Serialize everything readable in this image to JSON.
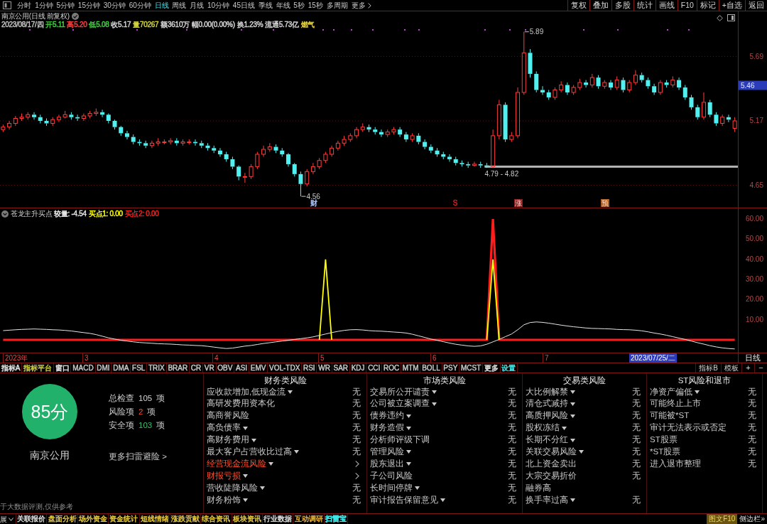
{
  "toolbar": {
    "periods": [
      {
        "label": "分时",
        "selected": false
      },
      {
        "label": "1分钟",
        "selected": false
      },
      {
        "label": "5分钟",
        "selected": false
      },
      {
        "label": "15分钟",
        "selected": false
      },
      {
        "label": "30分钟",
        "selected": false
      },
      {
        "label": "60分钟",
        "selected": false
      },
      {
        "label": "日线",
        "selected": true
      },
      {
        "label": "周线",
        "selected": false
      },
      {
        "label": "月线",
        "selected": false
      },
      {
        "label": "10分钟",
        "selected": false
      },
      {
        "label": "45日线",
        "selected": false
      },
      {
        "label": "季线",
        "selected": false
      },
      {
        "label": "年线",
        "selected": false
      },
      {
        "label": "5秒",
        "selected": false
      },
      {
        "label": "15秒",
        "selected": false
      },
      {
        "label": "多周期",
        "selected": false
      }
    ],
    "more": "更多",
    "buttons": [
      "复权",
      "叠加",
      "多股",
      "统计",
      "画线",
      "F10",
      "标记",
      "+自选",
      "返回"
    ]
  },
  "price_panel": {
    "title": "南京公用(日线 前复权)",
    "quote": [
      {
        "text": "2023/08/17/四",
        "color": "#c4c4c4"
      },
      {
        "text": "开5.11",
        "color": "#3ed23e"
      },
      {
        "text": "高5.20",
        "color": "#ff4040"
      },
      {
        "text": "低5.08",
        "color": "#3ed23e"
      },
      {
        "text": "收5.17",
        "color": "#d4d4d4"
      },
      {
        "text": "量70267",
        "color": "#d2d23c"
      },
      {
        "text": "额3610万",
        "color": "#d4d4d4"
      },
      {
        "text": "幅0.00(0.00%)",
        "color": "#d4d4d4"
      },
      {
        "text": "换1.23%",
        "color": "#d4d4d4"
      },
      {
        "text": "流通5.73亿",
        "color": "#d4d4d4"
      },
      {
        "text": "燃气",
        "color": "#e6d23c"
      }
    ],
    "chart_data": {
      "type": "candlestick",
      "ylim": [
        4.469,
        6.055
      ],
      "yticks": [
        {
          "value": 5.69,
          "label": "5.69"
        },
        {
          "value": 5.17,
          "label": "5.17"
        },
        {
          "value": 4.65,
          "label": "4.65"
        }
      ],
      "grid": true,
      "ohlc": [
        [
          5.1,
          5.14,
          5.08,
          5.12
        ],
        [
          5.12,
          5.17,
          5.1,
          5.15
        ],
        [
          5.15,
          5.21,
          5.13,
          5.19
        ],
        [
          5.19,
          5.23,
          5.17,
          5.2
        ],
        [
          5.2,
          5.24,
          5.18,
          5.22
        ],
        [
          5.22,
          5.24,
          5.18,
          5.2
        ],
        [
          5.2,
          5.22,
          5.15,
          5.17
        ],
        [
          5.17,
          5.19,
          5.13,
          5.15
        ],
        [
          5.15,
          5.2,
          5.13,
          5.18
        ],
        [
          5.18,
          5.22,
          5.16,
          5.2
        ],
        [
          5.2,
          5.25,
          5.19,
          5.22
        ],
        [
          5.22,
          5.24,
          5.18,
          5.2
        ],
        [
          5.2,
          5.22,
          5.17,
          5.19
        ],
        [
          5.19,
          5.23,
          5.17,
          5.21
        ],
        [
          5.21,
          5.25,
          5.19,
          5.23
        ],
        [
          5.23,
          5.27,
          5.21,
          5.24
        ],
        [
          5.24,
          5.26,
          5.2,
          5.22
        ],
        [
          5.22,
          5.23,
          5.15,
          5.17
        ],
        [
          5.17,
          5.18,
          5.1,
          5.12
        ],
        [
          5.12,
          5.13,
          5.05,
          5.07
        ],
        [
          5.07,
          5.09,
          5.02,
          5.04
        ],
        [
          5.04,
          5.06,
          4.98,
          5.0
        ],
        [
          5.0,
          5.02,
          4.97,
          4.99
        ],
        [
          4.99,
          5.01,
          4.95,
          4.97
        ],
        [
          4.97,
          5.01,
          4.95,
          4.99
        ],
        [
          4.99,
          5.03,
          4.97,
          5.0
        ],
        [
          5.0,
          5.02,
          4.98,
          5.0
        ],
        [
          5.0,
          5.03,
          4.98,
          5.01
        ],
        [
          5.01,
          5.03,
          4.97,
          4.99
        ],
        [
          4.99,
          5.02,
          4.97,
          5.0
        ],
        [
          5.0,
          5.02,
          4.98,
          5.0
        ],
        [
          5.0,
          5.02,
          4.97,
          4.99
        ],
        [
          4.99,
          5.01,
          4.95,
          4.97
        ],
        [
          4.97,
          4.99,
          4.93,
          4.95
        ],
        [
          4.95,
          4.97,
          4.91,
          4.93
        ],
        [
          4.93,
          4.95,
          4.88,
          4.9
        ],
        [
          4.9,
          4.92,
          4.84,
          4.86
        ],
        [
          4.86,
          4.88,
          4.78,
          4.8
        ],
        [
          4.8,
          4.81,
          4.69,
          4.72
        ],
        [
          4.72,
          4.75,
          4.67,
          4.72
        ],
        [
          4.72,
          4.82,
          4.7,
          4.8
        ],
        [
          4.8,
          4.92,
          4.78,
          4.9
        ],
        [
          4.9,
          4.97,
          4.88,
          4.94
        ],
        [
          4.94,
          4.99,
          4.92,
          4.96
        ],
        [
          4.96,
          4.98,
          4.91,
          4.93
        ],
        [
          4.93,
          4.95,
          4.88,
          4.9
        ],
        [
          4.9,
          4.91,
          4.8,
          4.82
        ],
        [
          4.82,
          4.83,
          4.72,
          4.74
        ],
        [
          4.74,
          4.76,
          4.56,
          4.66
        ],
        [
          4.66,
          4.78,
          4.64,
          4.76
        ],
        [
          4.76,
          4.83,
          4.74,
          4.8
        ],
        [
          4.8,
          4.87,
          4.78,
          4.85
        ],
        [
          4.85,
          4.92,
          4.83,
          4.9
        ],
        [
          4.9,
          4.97,
          4.88,
          4.95
        ],
        [
          4.95,
          5.01,
          4.93,
          4.99
        ],
        [
          4.99,
          5.05,
          4.97,
          5.02
        ],
        [
          5.02,
          5.07,
          5.0,
          5.05
        ],
        [
          5.05,
          5.12,
          5.03,
          5.1
        ],
        [
          5.1,
          5.15,
          5.08,
          5.12
        ],
        [
          5.12,
          5.14,
          5.08,
          5.1
        ],
        [
          5.1,
          5.12,
          5.06,
          5.08
        ],
        [
          5.08,
          5.1,
          5.04,
          5.06
        ],
        [
          5.06,
          5.1,
          5.04,
          5.08
        ],
        [
          5.08,
          5.12,
          5.06,
          5.1
        ],
        [
          5.1,
          5.12,
          5.04,
          5.06
        ],
        [
          5.06,
          5.08,
          5.0,
          5.02
        ],
        [
          5.02,
          5.07,
          5.0,
          5.05
        ],
        [
          5.05,
          5.07,
          4.98,
          5.0
        ],
        [
          5.0,
          5.02,
          4.94,
          4.96
        ],
        [
          4.96,
          4.98,
          4.91,
          4.93
        ],
        [
          4.93,
          4.95,
          4.88,
          4.9
        ],
        [
          4.9,
          4.92,
          4.86,
          4.88
        ],
        [
          4.88,
          4.9,
          4.84,
          4.86
        ],
        [
          4.86,
          4.88,
          4.81,
          4.83
        ],
        [
          4.83,
          4.85,
          4.8,
          4.82
        ],
        [
          4.82,
          4.84,
          4.79,
          4.81
        ],
        [
          4.81,
          4.84,
          4.8,
          4.82
        ],
        [
          4.82,
          4.84,
          4.79,
          4.81
        ],
        [
          4.81,
          4.83,
          4.79,
          4.8
        ],
        [
          4.8,
          5.1,
          4.79,
          5.05
        ],
        [
          5.05,
          5.34,
          5.02,
          5.3
        ],
        [
          5.3,
          5.32,
          5.0,
          5.02
        ],
        [
          5.02,
          5.08,
          5.0,
          5.05
        ],
        [
          5.05,
          5.44,
          5.03,
          5.4
        ],
        [
          5.4,
          5.89,
          5.38,
          5.72
        ],
        [
          5.72,
          5.75,
          5.52,
          5.55
        ],
        [
          5.55,
          5.57,
          5.4,
          5.42
        ],
        [
          5.42,
          5.45,
          5.38,
          5.4
        ],
        [
          5.4,
          5.42,
          5.34,
          5.36
        ],
        [
          5.36,
          5.44,
          5.34,
          5.42
        ],
        [
          5.42,
          5.49,
          5.4,
          5.46
        ],
        [
          5.46,
          5.48,
          5.38,
          5.4
        ],
        [
          5.4,
          5.46,
          5.38,
          5.44
        ],
        [
          5.44,
          5.51,
          5.42,
          5.48
        ],
        [
          5.48,
          5.5,
          5.44,
          5.46
        ],
        [
          5.46,
          5.55,
          5.44,
          5.52
        ],
        [
          5.52,
          5.54,
          5.43,
          5.45
        ],
        [
          5.45,
          5.5,
          5.43,
          5.48
        ],
        [
          5.48,
          5.5,
          5.42,
          5.44
        ],
        [
          5.44,
          5.53,
          5.42,
          5.5
        ],
        [
          5.5,
          5.52,
          5.4,
          5.42
        ],
        [
          5.42,
          5.5,
          5.4,
          5.48
        ],
        [
          5.48,
          5.58,
          5.46,
          5.54
        ],
        [
          5.54,
          5.56,
          5.48,
          5.5
        ],
        [
          5.5,
          5.52,
          5.43,
          5.45
        ],
        [
          5.45,
          5.47,
          5.38,
          5.4
        ],
        [
          5.4,
          5.5,
          5.38,
          5.48
        ],
        [
          5.48,
          5.5,
          5.44,
          5.46
        ],
        [
          5.46,
          5.53,
          5.44,
          5.5
        ],
        [
          5.5,
          5.52,
          5.42,
          5.44
        ],
        [
          5.44,
          5.46,
          5.34,
          5.36
        ],
        [
          5.36,
          5.38,
          5.26,
          5.28
        ],
        [
          5.28,
          5.3,
          5.18,
          5.2
        ],
        [
          5.2,
          5.4,
          5.18,
          5.32
        ],
        [
          5.32,
          5.34,
          5.2,
          5.22
        ],
        [
          5.22,
          5.24,
          5.13,
          5.15
        ],
        [
          5.15,
          5.22,
          5.13,
          5.2
        ],
        [
          5.2,
          5.22,
          5.16,
          5.18
        ],
        [
          5.11,
          5.2,
          5.08,
          5.17
        ]
      ],
      "annotations": [
        "5.89",
        "5.46",
        "4.79 - 4.82",
        "4.56"
      ]
    },
    "event_marks": [
      {
        "text": "财",
        "color": "#a8c4ff",
        "boxed": false
      },
      {
        "text": "S",
        "color": "#e02020",
        "boxed": false
      },
      {
        "text": "涨",
        "color": "#8a2020",
        "boxed": true
      },
      {
        "text": "预",
        "color": "#a85a20",
        "boxed": true
      }
    ]
  },
  "indicator_panel": {
    "name": "苍龙主升买点",
    "readouts": [
      {
        "text": "较量: -4.54",
        "color": "#e6e6e6"
      },
      {
        "text": "买点1: 0.00",
        "color": "#ffff00"
      },
      {
        "text": "买点2: 0.00",
        "color": "#ff1e1e"
      }
    ],
    "chart_data": {
      "type": "line",
      "ylim": [
        -6.35,
        65.65
      ],
      "yticks": [
        {
          "value": 60,
          "label": "60.00"
        },
        {
          "value": 50,
          "label": "50.00"
        },
        {
          "value": 40,
          "label": "40.00"
        },
        {
          "value": 30,
          "label": "30.00"
        },
        {
          "value": 20,
          "label": "20.00"
        },
        {
          "value": 10,
          "label": "10.00"
        }
      ],
      "series": [
        {
          "color": "#e6e6e6",
          "values": [
            4.6,
            4.8,
            5.0,
            5.2,
            5.3,
            5.4,
            5.3,
            5.2,
            5.0,
            4.9,
            4.7,
            4.4,
            4.0,
            3.6,
            3.2,
            2.6,
            1.8,
            1.0,
            0.4,
            -0.2,
            -0.6,
            -1.0,
            -1.3,
            -1.5,
            -1.7,
            -1.9,
            -2.0,
            -2.1,
            -2.3,
            -2.5,
            -2.6,
            -2.8,
            -2.9,
            -3.2,
            -3.6,
            -4.0,
            -4.3,
            -4.1,
            -3.6,
            -3.1,
            -2.8,
            -2.3,
            -1.8,
            -1.4,
            -1.0,
            -0.6,
            -0.2,
            0.2,
            0.6,
            1.0,
            1.5,
            2.2,
            2.9,
            3.6,
            4.2,
            4.7,
            5.0,
            5.1,
            4.9,
            4.6,
            4.4,
            4.3,
            4.1,
            3.9,
            3.7,
            3.4,
            2.8,
            2.0,
            1.2,
            0.4,
            -0.2,
            -0.9,
            -1.6,
            -2.2,
            -2.6,
            -3.0,
            -3.2,
            -3.0,
            -2.2,
            -1.0,
            0.2,
            1.6,
            2.9,
            5.0,
            7.5,
            8.6,
            8.9,
            8.7,
            8.3,
            7.8,
            7.3,
            6.9,
            6.5,
            6.2,
            5.9,
            5.7,
            5.6,
            5.5,
            5.4,
            5.2,
            5.1,
            5.0,
            4.8,
            4.5,
            4.0,
            3.4,
            2.9,
            2.3,
            1.6,
            0.9,
            0.2,
            -0.6,
            -1.4,
            -2.1,
            -2.9,
            -3.5,
            -4.0,
            -4.3,
            -4.5
          ]
        },
        {
          "color": "#ffff00",
          "values": [
            null,
            null,
            null,
            null,
            null,
            null,
            null,
            null,
            null,
            null,
            null,
            null,
            null,
            null,
            null,
            null,
            null,
            null,
            null,
            null,
            null,
            null,
            null,
            null,
            null,
            null,
            null,
            null,
            null,
            null,
            null,
            null,
            null,
            null,
            null,
            null,
            null,
            null,
            null,
            null,
            null,
            null,
            null,
            null,
            null,
            null,
            null,
            null,
            null,
            null,
            null,
            0,
            40,
            0,
            null,
            null,
            null,
            null,
            null,
            null,
            null,
            null,
            null,
            null,
            null,
            null,
            null,
            null,
            null,
            null,
            null,
            null,
            null,
            null,
            null,
            null,
            null,
            null,
            0,
            40,
            0,
            null,
            null,
            null,
            null,
            null,
            null,
            null,
            null,
            null,
            null,
            null,
            null,
            null,
            null,
            null,
            null,
            null,
            null,
            null,
            null,
            null,
            null,
            null,
            null,
            null,
            null,
            null,
            null,
            null,
            null,
            null,
            null,
            null,
            null,
            null,
            null,
            null,
            null
          ]
        },
        {
          "color": "#ff1e1e",
          "values": [
            0,
            0,
            0,
            0,
            0,
            0,
            0,
            0,
            0,
            0,
            0,
            0,
            0,
            0,
            0,
            0,
            0,
            0,
            0,
            0,
            0,
            0,
            0,
            0,
            0,
            0,
            0,
            0,
            0,
            0,
            0,
            0,
            0,
            0,
            0,
            0,
            0,
            0,
            0,
            0,
            0,
            0,
            0,
            0,
            0,
            0,
            0,
            0,
            0,
            0,
            0,
            0,
            0,
            0,
            0,
            0,
            0,
            0,
            0,
            0,
            0,
            0,
            0,
            0,
            0,
            0,
            0,
            0,
            0,
            0,
            0,
            0,
            0,
            0,
            0,
            0,
            0,
            0,
            0,
            60,
            0,
            0,
            0,
            0,
            0,
            0,
            0,
            0,
            0,
            0,
            0,
            0,
            0,
            0,
            0,
            0,
            0,
            0,
            0,
            0,
            0,
            0,
            0,
            0,
            0,
            0,
            0,
            0,
            0,
            0,
            0,
            0,
            0,
            0,
            0,
            0,
            0,
            0,
            0
          ]
        }
      ]
    }
  },
  "date_axis": {
    "ticks": [
      "2023年",
      "3",
      "4",
      "5",
      "6",
      "7"
    ],
    "cursor_date": "2023/07/25/二",
    "period": "日线"
  },
  "indicator_tabs": {
    "items": [
      {
        "label": "指标A",
        "color": "#e6e6e6"
      },
      {
        "label": "指标平台",
        "color": "#d2d23c"
      },
      {
        "label": "窗口",
        "color": "#e6e6e6"
      },
      {
        "label": "MACD",
        "color": "#c8c8c8"
      },
      {
        "label": "DMI",
        "color": "#c8c8c8"
      },
      {
        "label": "DMA",
        "color": "#c8c8c8"
      },
      {
        "label": "FSL",
        "color": "#c8c8c8"
      },
      {
        "label": "TRIX",
        "color": "#c8c8c8"
      },
      {
        "label": "BRAR",
        "color": "#c8c8c8"
      },
      {
        "label": "CR",
        "color": "#c8c8c8"
      },
      {
        "label": "VR",
        "color": "#c8c8c8"
      },
      {
        "label": "OBV",
        "color": "#c8c8c8"
      },
      {
        "label": "ASI",
        "color": "#c8c8c8"
      },
      {
        "label": "EMV",
        "color": "#c8c8c8"
      },
      {
        "label": "VOL-TDX",
        "color": "#c8c8c8"
      },
      {
        "label": "RSI",
        "color": "#c8c8c8"
      },
      {
        "label": "WR",
        "color": "#c8c8c8"
      },
      {
        "label": "SAR",
        "color": "#c8c8c8"
      },
      {
        "label": "KDJ",
        "color": "#c8c8c8"
      },
      {
        "label": "CCI",
        "color": "#c8c8c8"
      },
      {
        "label": "ROC",
        "color": "#c8c8c8"
      },
      {
        "label": "MTM",
        "color": "#c8c8c8"
      },
      {
        "label": "BOLL",
        "color": "#c8c8c8"
      },
      {
        "label": "PSY",
        "color": "#c8c8c8"
      },
      {
        "label": "MCST",
        "color": "#c8c8c8"
      },
      {
        "label": "更多",
        "color": "#e6e6e6"
      },
      {
        "label": "设置",
        "color": "#3ce6e6"
      }
    ],
    "right": [
      "指标B",
      "模板",
      "+",
      "−"
    ]
  },
  "risk_scan": {
    "score": "85分",
    "stock_name": "南京公用",
    "stats": [
      {
        "label": "总检查",
        "count": "105",
        "unit": "项",
        "kind": "total"
      },
      {
        "label": "风险项",
        "count": "2",
        "unit": "项",
        "kind": "risk"
      },
      {
        "label": "安全项",
        "count": "103",
        "unit": "项",
        "kind": "safe"
      }
    ],
    "more_link": "更多扫雷避险 >",
    "disclaimer": "于大数据评测,仅供参考",
    "categories": [
      {
        "title": "财务类风险",
        "items": [
          {
            "label": "应收款增加,低现金流",
            "menu": true,
            "risk": false,
            "result": "无"
          },
          {
            "label": "高研发费用资本化",
            "menu": false,
            "risk": false,
            "result": "无"
          },
          {
            "label": "高商誉风险",
            "menu": false,
            "risk": false,
            "result": "无"
          },
          {
            "label": "高负债率",
            "menu": true,
            "risk": false,
            "result": "无"
          },
          {
            "label": "高财务费用",
            "menu": true,
            "risk": false,
            "result": "无"
          },
          {
            "label": "最大客户占营收比过高",
            "menu": true,
            "risk": false,
            "result": "无"
          },
          {
            "label": "经营现金流风险",
            "menu": true,
            "risk": true
          },
          {
            "label": "财报亏损",
            "menu": true,
            "risk": true
          },
          {
            "label": "营收陡降风险",
            "menu": true,
            "risk": false,
            "result": "无"
          },
          {
            "label": "财务粉饰",
            "menu": true,
            "risk": false,
            "result": "无"
          }
        ]
      },
      {
        "title": "市场类风险",
        "items": [
          {
            "label": "交易所公开谴责",
            "menu": true,
            "risk": false,
            "result": "无"
          },
          {
            "label": "公司被立案调查",
            "menu": true,
            "risk": false,
            "result": "无"
          },
          {
            "label": "债券违约",
            "menu": true,
            "risk": false,
            "result": "无"
          },
          {
            "label": "财务造假",
            "menu": true,
            "risk": false,
            "result": "无"
          },
          {
            "label": "分析师评级下调",
            "menu": false,
            "risk": false,
            "result": "无"
          },
          {
            "label": "管理风险",
            "menu": true,
            "risk": false,
            "result": "无"
          },
          {
            "label": "股东退出",
            "menu": true,
            "risk": false,
            "result": "无"
          },
          {
            "label": "子公司风险",
            "menu": false,
            "risk": false,
            "result": "无"
          },
          {
            "label": "长时间停牌",
            "menu": true,
            "risk": false,
            "result": "无"
          },
          {
            "label": "审计报告保留意见",
            "menu": true,
            "risk": false,
            "result": "无"
          }
        ]
      },
      {
        "title": "交易类风险",
        "items": [
          {
            "label": "大比例解禁",
            "menu": true,
            "risk": false,
            "result": "无"
          },
          {
            "label": "清仓式减持",
            "menu": true,
            "risk": false,
            "result": "无"
          },
          {
            "label": "高质押风险",
            "menu": true,
            "risk": false,
            "result": "无"
          },
          {
            "label": "股权冻结",
            "menu": true,
            "risk": false,
            "result": "无"
          },
          {
            "label": "长期不分红",
            "menu": true,
            "risk": false,
            "result": "无"
          },
          {
            "label": "关联交易风险",
            "menu": true,
            "risk": false,
            "result": "无"
          },
          {
            "label": "北上资金卖出",
            "menu": false,
            "risk": false,
            "result": "无"
          },
          {
            "label": "大宗交易折价",
            "menu": false,
            "risk": false,
            "result": "无"
          },
          {
            "label": "融券高",
            "menu": false,
            "risk": false
          },
          {
            "label": "换手率过高",
            "menu": true,
            "risk": false,
            "result": "无"
          }
        ]
      },
      {
        "title": "ST风险和退市",
        "items": [
          {
            "label": "净资产偏低",
            "menu": true,
            "risk": false,
            "result": "无"
          },
          {
            "label": "可能终止上市",
            "menu": false,
            "risk": false,
            "result": "无"
          },
          {
            "label": "可能被*ST",
            "menu": false,
            "risk": false,
            "result": "无"
          },
          {
            "label": "审计无法表示或否定",
            "menu": false,
            "risk": false,
            "result": "无"
          },
          {
            "label": "ST股票",
            "menu": false,
            "risk": false,
            "result": "无"
          },
          {
            "label": "*ST股票",
            "menu": false,
            "risk": false,
            "result": "无"
          },
          {
            "label": "进入退市整理",
            "menu": false,
            "risk": false,
            "result": "无"
          }
        ]
      }
    ]
  },
  "bottom_tabs": {
    "lead": "展",
    "items": [
      {
        "label": "关联报价",
        "color": "#dcdcdc",
        "selected": false
      },
      {
        "label": "盘面分析",
        "color": "#e6c83c",
        "selected": false
      },
      {
        "label": "场外资金",
        "color": "#e6c83c",
        "selected": false
      },
      {
        "label": "资金统计",
        "color": "#e6c83c",
        "selected": false
      },
      {
        "label": "短线情绪",
        "color": "#e6c83c",
        "selected": false
      },
      {
        "label": "涨跌贡献",
        "color": "#e6c83c",
        "selected": false
      },
      {
        "label": "综合资讯",
        "color": "#e6c83c",
        "selected": false
      },
      {
        "label": "板块资讯",
        "color": "#e6c83c",
        "selected": false
      },
      {
        "label": "行业数据",
        "color": "#dcdcdc",
        "selected": false
      },
      {
        "label": "互动调研",
        "color": "#e6b43c",
        "selected": false
      },
      {
        "label": "扫雷宝",
        "color": "#3ce6e6",
        "selected": true
      }
    ],
    "right": [
      {
        "label": "图文F10",
        "kind": "accent"
      },
      {
        "label": "侧边栏»",
        "kind": "plain"
      }
    ]
  }
}
